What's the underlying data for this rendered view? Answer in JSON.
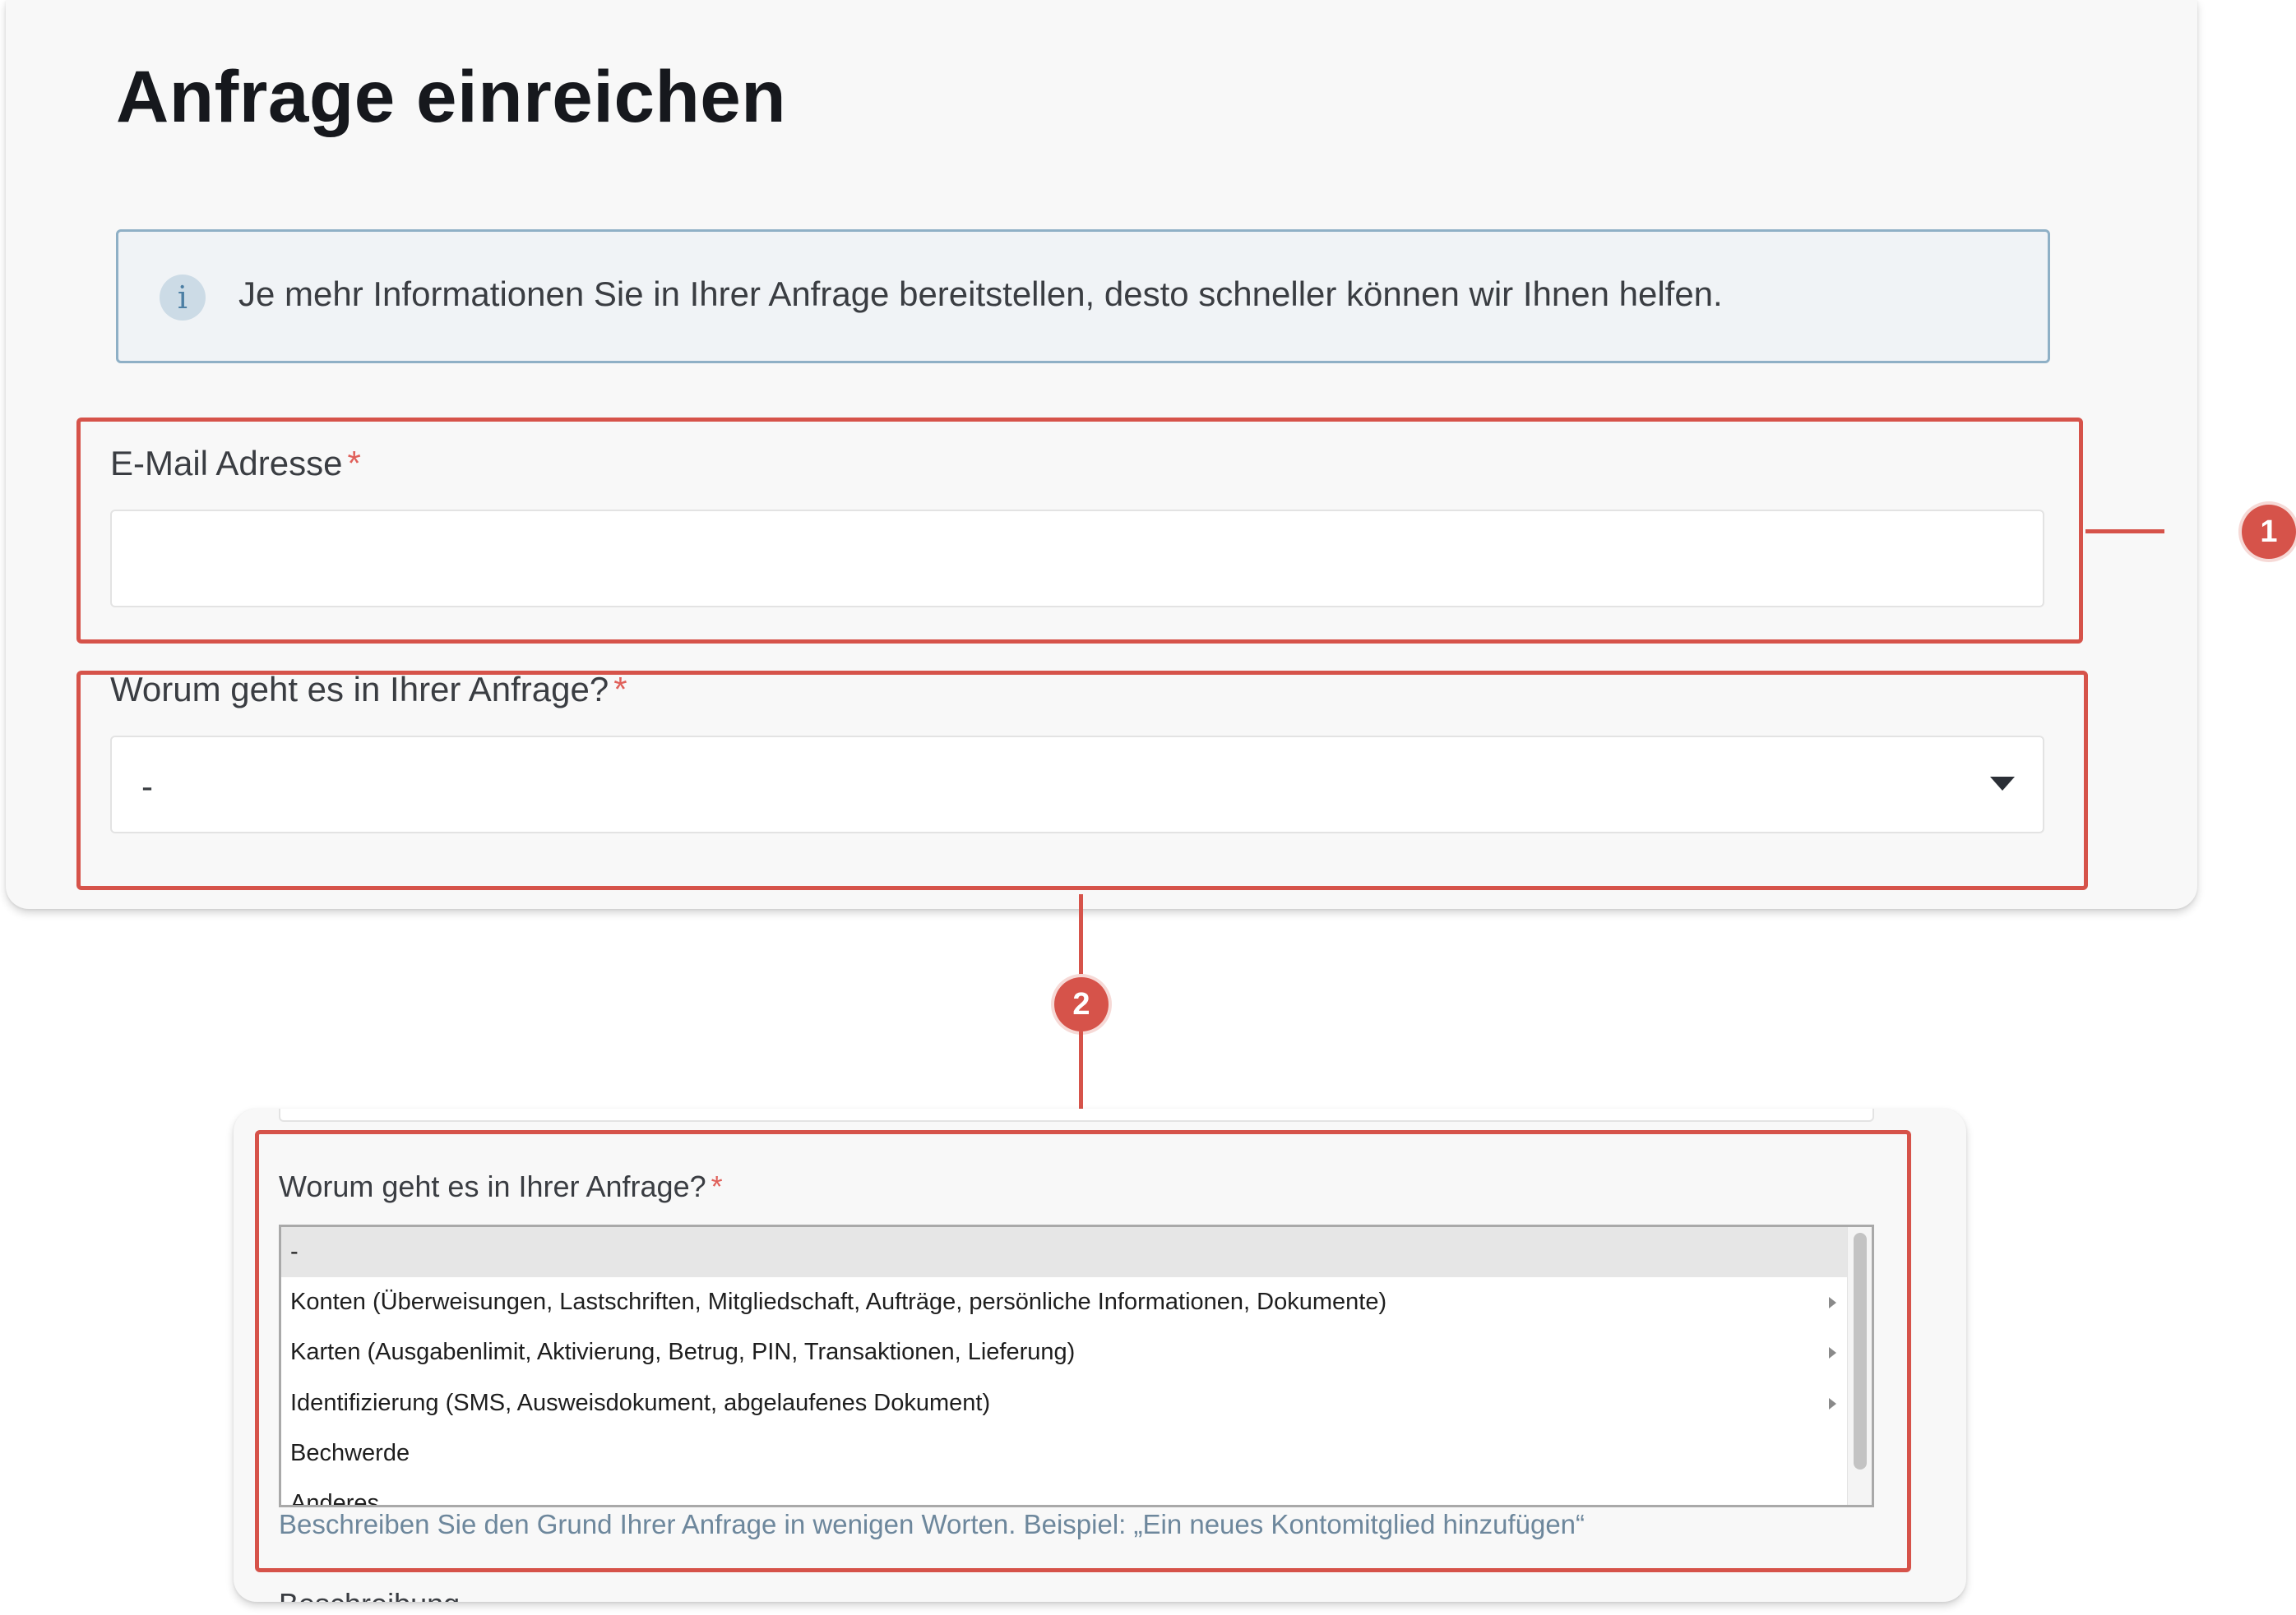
{
  "page": {
    "title": "Anfrage einreichen",
    "info_message": "Je mehr Informationen Sie in Ihrer Anfrage bereitstellen, desto schneller können wir Ihnen helfen."
  },
  "form": {
    "email": {
      "label": "E-Mail Adresse",
      "required_marker": "*",
      "value": ""
    },
    "topic": {
      "label": "Worum geht es in Ihrer Anfrage?",
      "required_marker": "*",
      "selected_value": "-"
    }
  },
  "dropdown_expanded": {
    "label": "Worum geht es in Ihrer Anfrage?",
    "required_marker": "*",
    "options": [
      {
        "label": "-",
        "selected": true,
        "has_submenu": false
      },
      {
        "label": "Konten (Überweisungen, Lastschriften, Mitgliedschaft, Aufträge, persönliche Informationen, Dokumente)",
        "selected": false,
        "has_submenu": true
      },
      {
        "label": "Karten (Ausgabenlimit, Aktivierung, Betrug, PIN, Transaktionen, Lieferung)",
        "selected": false,
        "has_submenu": true
      },
      {
        "label": "Identifizierung (SMS, Ausweisdokument, abgelaufenes Dokument)",
        "selected": false,
        "has_submenu": true
      },
      {
        "label": "Bechwerde",
        "selected": false,
        "has_submenu": false
      },
      {
        "label": "Anderes",
        "selected": false,
        "has_submenu": false
      }
    ],
    "help_text": "Beschreiben Sie den Grund Ihrer Anfrage in wenigen Worten. Beispiel: „Ein neues Kontomitglied hinzufügen“",
    "next_field_label_partial": "Beschreibung"
  },
  "annotations": [
    {
      "number": "1",
      "target": "email-field"
    },
    {
      "number": "2",
      "target": "topic-field"
    }
  ],
  "colors": {
    "highlight": "#d6534a",
    "info_border": "#8fb0c6",
    "info_background": "#f0f3f6",
    "required": "#e0605a",
    "help_text": "#6d879c"
  }
}
